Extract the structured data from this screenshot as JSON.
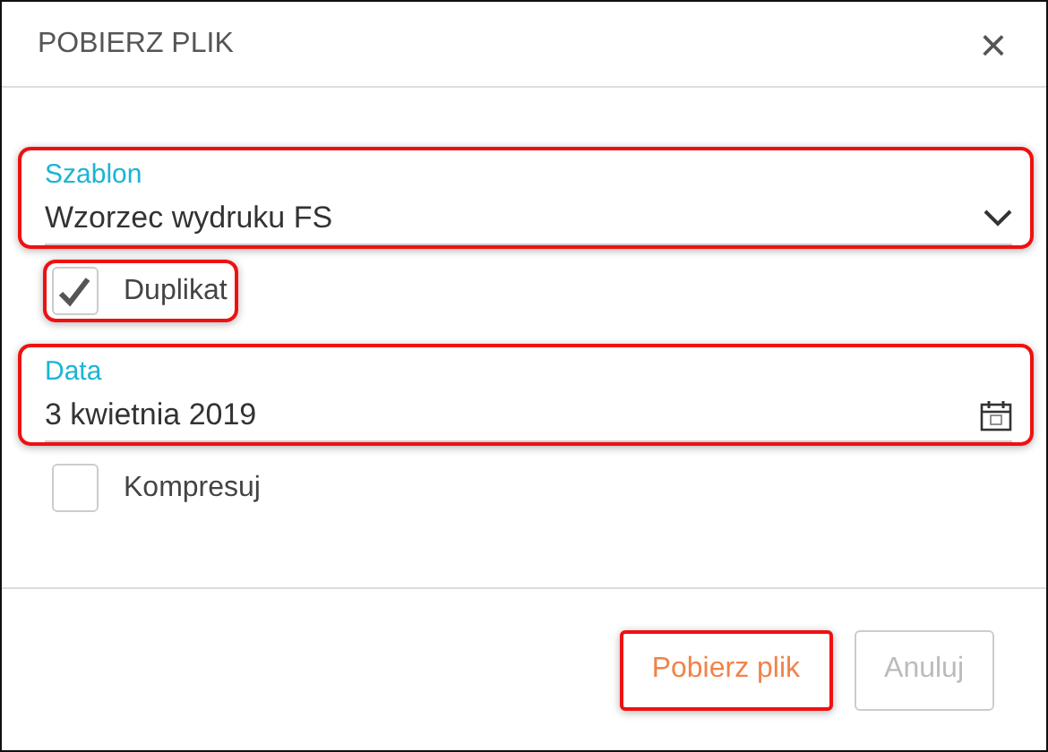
{
  "dialog": {
    "title": "POBIERZ PLIK",
    "close": "×"
  },
  "fields": [
    {
      "kind": "select",
      "label": "Szablon",
      "value": "Wzorzec wydruku FS",
      "highlighted": true
    },
    {
      "kind": "checkbox",
      "label": "Duplikat",
      "checked": true,
      "highlighted": true
    },
    {
      "kind": "date",
      "label": "Data",
      "value": "3 kwietnia 2019",
      "highlighted": true
    },
    {
      "kind": "checkbox",
      "label": "Kompresuj",
      "checked": false,
      "highlighted": false
    }
  ],
  "buttons": [
    {
      "label": "Pobierz plik",
      "disabled": false,
      "highlighted": true
    },
    {
      "label": "Anuluj",
      "disabled": true,
      "highlighted": false
    }
  ]
}
